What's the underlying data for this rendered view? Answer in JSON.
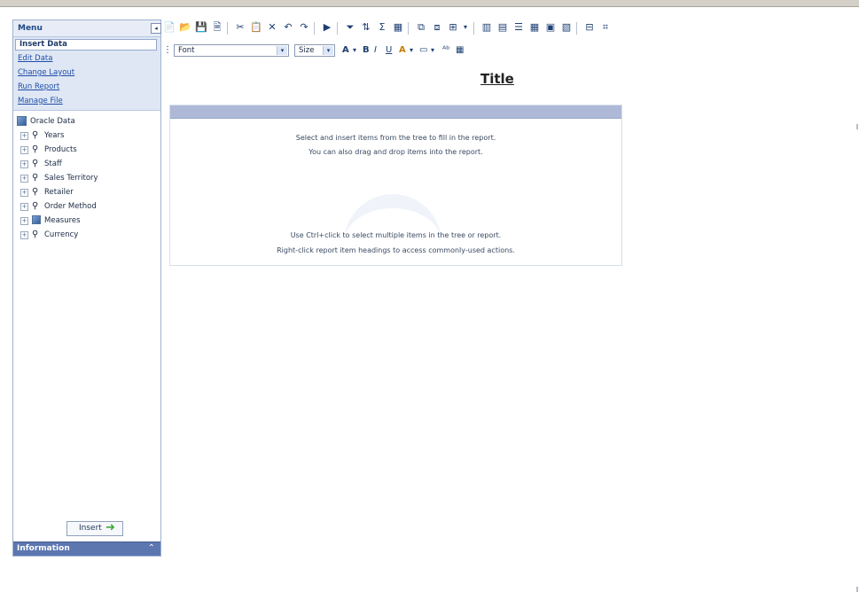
{
  "menu": {
    "title": "Menu",
    "items": [
      {
        "label": "Insert Data",
        "active": true
      },
      {
        "label": "Edit Data"
      },
      {
        "label": "Change Layout"
      },
      {
        "label": "Run Report"
      },
      {
        "label": "Manage File"
      }
    ]
  },
  "tree": {
    "root": "Oracle Data",
    "items": [
      {
        "label": "Years",
        "icon": "hierarchy-icon"
      },
      {
        "label": "Products",
        "icon": "hierarchy-icon"
      },
      {
        "label": "Staff",
        "icon": "hierarchy-icon"
      },
      {
        "label": "Sales Territory",
        "icon": "hierarchy-icon"
      },
      {
        "label": "Retailer",
        "icon": "hierarchy-icon"
      },
      {
        "label": "Order Method",
        "icon": "hierarchy-icon"
      },
      {
        "label": "Measures",
        "icon": "measures-icon"
      },
      {
        "label": "Currency",
        "icon": "hierarchy-icon"
      }
    ]
  },
  "insert_button": {
    "label": "Insert"
  },
  "information": {
    "title": "Information"
  },
  "toolbar": {
    "icons": [
      "new-icon",
      "open-icon",
      "save-icon",
      "save-as-icon",
      "cut-icon",
      "paste-icon",
      "delete-icon",
      "undo-icon",
      "redo-icon",
      "run-icon",
      "filter-icon",
      "sort-icon",
      "sum-icon",
      "chart-icon",
      "group-icon",
      "ungroup-icon",
      "insert-icon",
      "bar-chart-icon",
      "layout-icon",
      "align-icon",
      "table-icon",
      "page-icon",
      "section-icon",
      "grid-icon"
    ]
  },
  "format": {
    "font_label": "Font",
    "size_label": "Size",
    "bold": "B",
    "italic": "I",
    "underline": "U",
    "text_color_label": "A",
    "fill_color_label": "A"
  },
  "report": {
    "title": "Title",
    "line1": "Select and insert items from the tree to fill in the report.",
    "line2": "You can also drag and drop items into the report.",
    "line3": "Use Ctrl+click to select multiple items in the tree or report.",
    "line4": "Right-click report item headings to access commonly-used actions."
  }
}
